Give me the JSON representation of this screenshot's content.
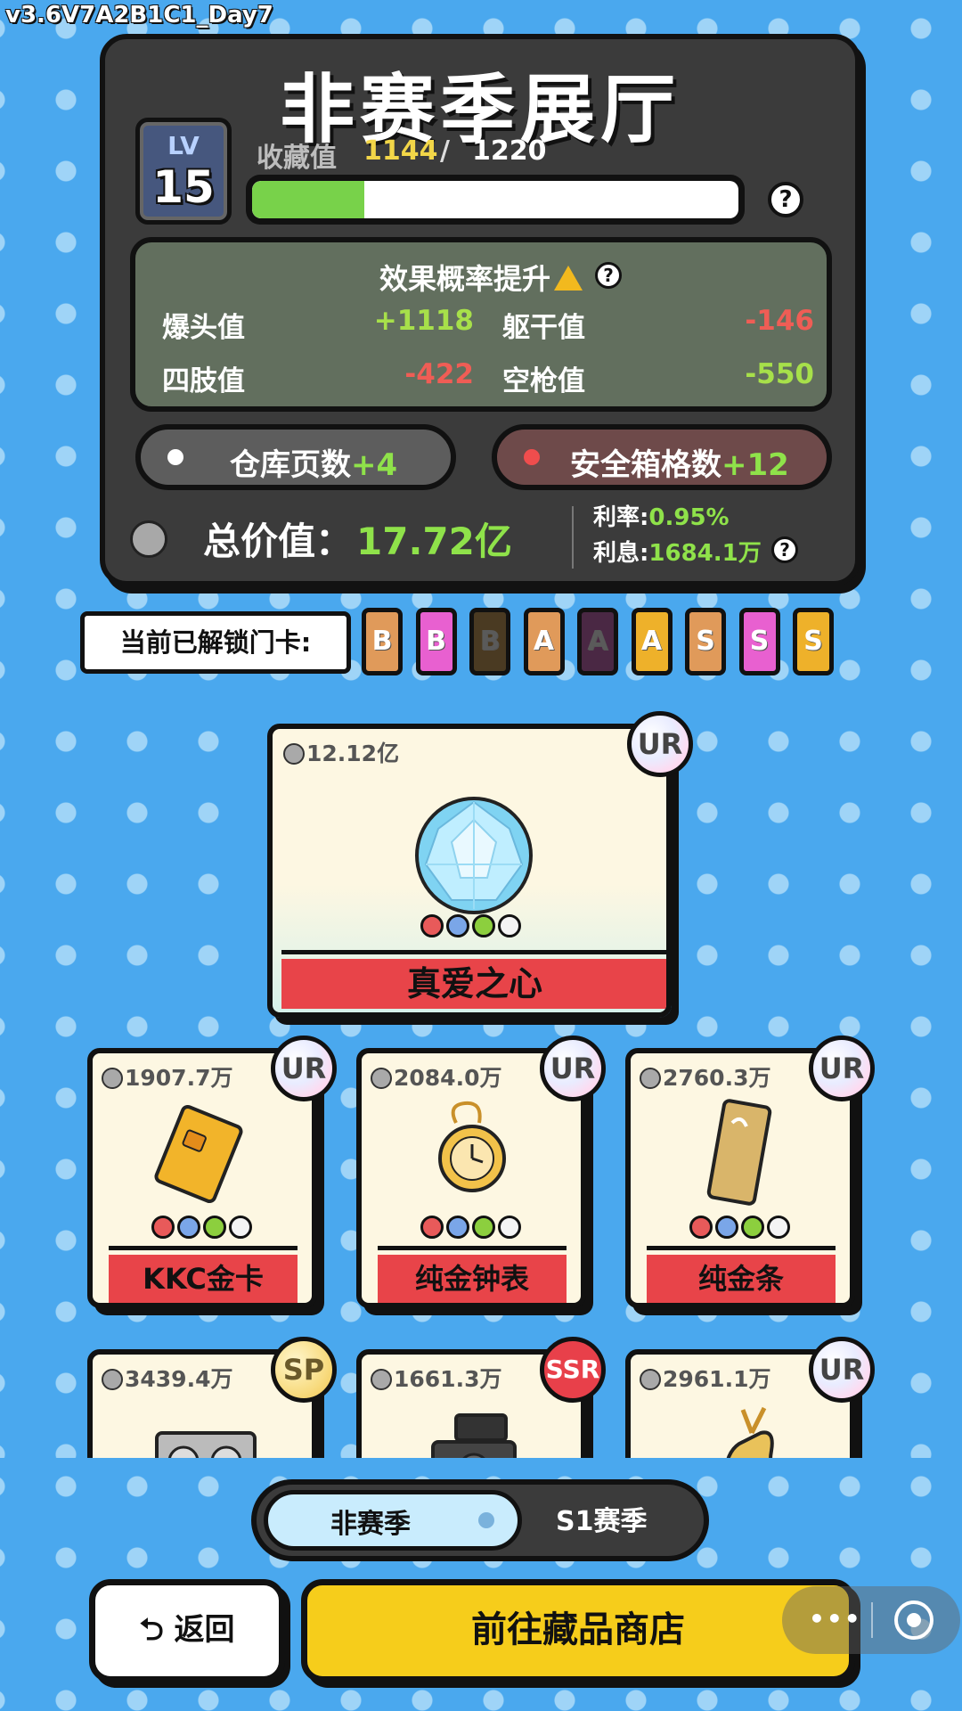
{
  "version": "v3.6V7A2B1C1_Day7",
  "hall": {
    "title": "非赛季展厅",
    "lv_label": "LV",
    "level": "15",
    "collect_label": "收藏值",
    "collect_current": "1144",
    "collect_sep": "/",
    "collect_max": "1220",
    "collect_progress": 0.23,
    "help": "?"
  },
  "effect": {
    "title": "效果概率提升",
    "stats": [
      {
        "label": "爆头值",
        "value": "+1118",
        "tone": "pos"
      },
      {
        "label": "躯干值",
        "value": "-146",
        "tone": "neg"
      },
      {
        "label": "四肢值",
        "value": "-422",
        "tone": "neg"
      },
      {
        "label": "空枪值",
        "value": "-550",
        "tone": "pos"
      }
    ]
  },
  "warehouse": {
    "label": "仓库页数",
    "bonus": "+4"
  },
  "safebox": {
    "label": "安全箱格数",
    "bonus": "+12"
  },
  "total": {
    "label": "总价值：",
    "value": "17.72亿"
  },
  "rate": {
    "label": "利率:",
    "value": "0.95%"
  },
  "interest": {
    "label": "利息:",
    "value": "1684.1万"
  },
  "unlock_label": "当前已解锁门卡:",
  "gates": [
    {
      "letter": "B",
      "color": "#e09a5a",
      "dim": false
    },
    {
      "letter": "B",
      "color": "#e860d0",
      "dim": false
    },
    {
      "letter": "B",
      "color": "#4a3a22",
      "dim": true
    },
    {
      "letter": "A",
      "color": "#e09a5a",
      "dim": false
    },
    {
      "letter": "A",
      "color": "#4a2844",
      "dim": true
    },
    {
      "letter": "A",
      "color": "#eeb12a",
      "dim": false
    },
    {
      "letter": "S",
      "color": "#e09a5a",
      "dim": false
    },
    {
      "letter": "S",
      "color": "#e860d0",
      "dim": false
    },
    {
      "letter": "S",
      "color": "#eeb12a",
      "dim": false
    }
  ],
  "featured": {
    "price": "12.12亿",
    "rarity": "UR",
    "name": "真爱之心",
    "icon": "diamond-heart-icon"
  },
  "items": [
    {
      "price": "1907.7万",
      "rarity": "UR",
      "name": "KKC金卡",
      "icon": "gold-card-icon"
    },
    {
      "price": "2084.0万",
      "rarity": "UR",
      "name": "纯金钟表",
      "icon": "gold-pocket-watch-icon"
    },
    {
      "price": "2760.3万",
      "rarity": "UR",
      "name": "纯金条",
      "icon": "gold-bar-icon"
    },
    {
      "price": "3439.4万",
      "rarity": "SP",
      "name": "",
      "icon": "graphics-card-icon"
    },
    {
      "price": "1661.3万",
      "rarity": "SSR",
      "name": "",
      "icon": "camera-icon"
    },
    {
      "price": "2961.1万",
      "rarity": "UR",
      "name": "",
      "icon": "gold-deer-icon"
    }
  ],
  "season_toggle": {
    "off_season": "非赛季",
    "s1": "S1赛季"
  },
  "buttons": {
    "back": "返回",
    "shop": "前往藏品商店"
  }
}
